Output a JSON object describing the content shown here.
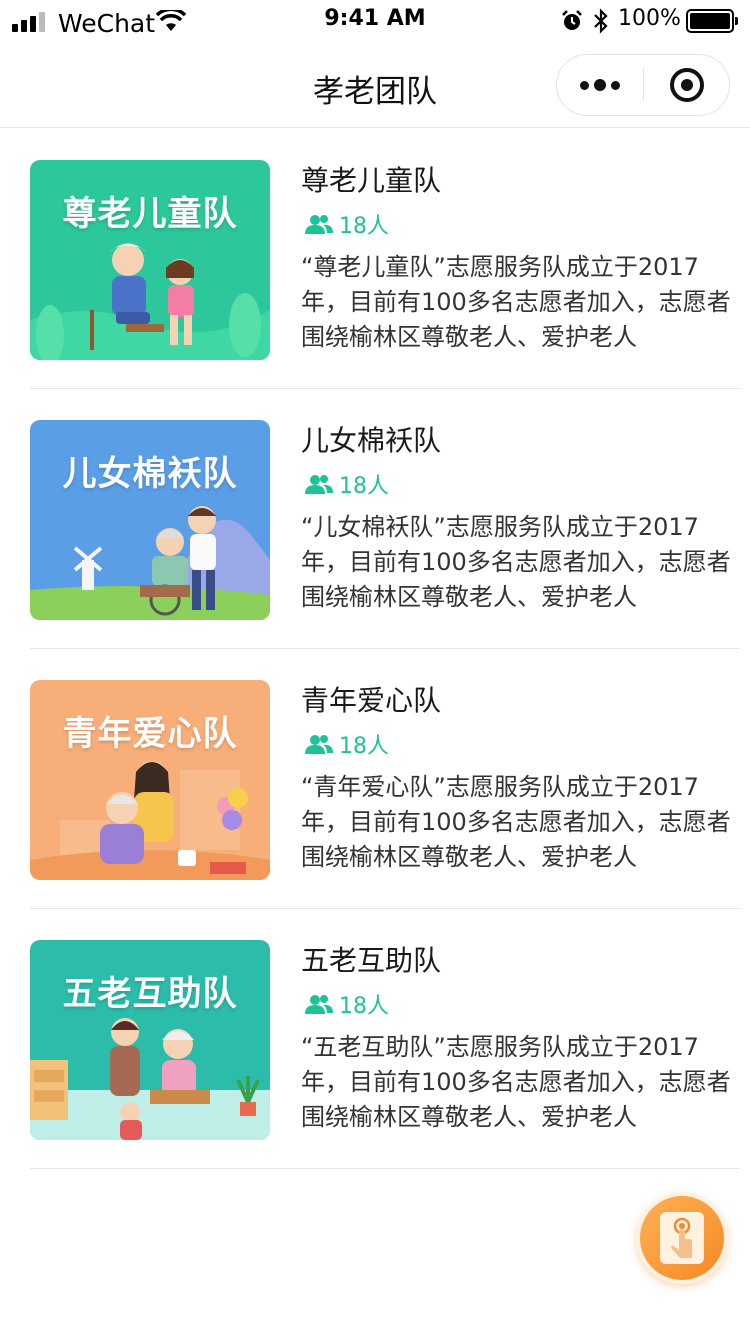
{
  "status_bar": {
    "carrier": "WeChat",
    "time": "9:41 AM",
    "battery": "100%"
  },
  "nav": {
    "title": "孝老团队"
  },
  "teams": [
    {
      "name": "尊老儿童队",
      "thumb_title": "尊老儿童队",
      "count": "18人",
      "desc": "“尊老儿童队”志愿服务队成立于2017年，目前有100多名志愿者加入，志愿者围绕榆林区尊敬老人、爱护老人",
      "bg_color": "#2cc79a"
    },
    {
      "name": "儿女棉袄队",
      "thumb_title": "儿女棉袄队",
      "count": "18人",
      "desc": "“儿女棉袄队”志愿服务队成立于2017年，目前有100多名志愿者加入，志愿者围绕榆林区尊敬老人、爱护老人",
      "bg_color": "#5a9ee6"
    },
    {
      "name": "青年爱心队",
      "thumb_title": "青年爱心队",
      "count": "18人",
      "desc": "“青年爱心队”志愿服务队成立于2017年，目前有100多名志愿者加入，志愿者围绕榆林区尊敬老人、爱护老人",
      "bg_color": "#f7ae78"
    },
    {
      "name": "五老互助队",
      "thumb_title": "五老互助队",
      "count": "18人",
      "desc": "“五老互助队”志愿服务队成立于2017年，目前有100多名志愿者加入，志愿者围绕榆林区尊敬老人、爱护老人",
      "bg_color": "#2bbcaa"
    }
  ],
  "icons": {
    "count_icon": "people-icon",
    "fab_icon": "touch-icon"
  },
  "colors": {
    "accent": "#1cc396",
    "fab": "#f48a24"
  }
}
